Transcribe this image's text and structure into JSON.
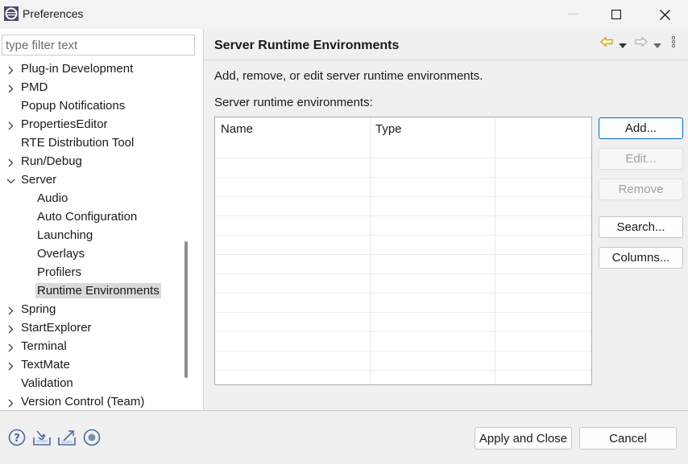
{
  "window": {
    "title": "Preferences",
    "icons": [
      "eclipse-app-icon",
      "minimize-icon",
      "maximize-icon",
      "close-icon"
    ]
  },
  "sidebar": {
    "filter_placeholder": "type filter text",
    "items": [
      {
        "label": "Plug-in Development",
        "level": 0,
        "expandable": true,
        "expanded": false
      },
      {
        "label": "PMD",
        "level": 0,
        "expandable": true,
        "expanded": false
      },
      {
        "label": "Popup Notifications",
        "level": 0,
        "expandable": false
      },
      {
        "label": "PropertiesEditor",
        "level": 0,
        "expandable": true,
        "expanded": false
      },
      {
        "label": "RTE Distribution Tool",
        "level": 0,
        "expandable": false
      },
      {
        "label": "Run/Debug",
        "level": 0,
        "expandable": true,
        "expanded": false
      },
      {
        "label": "Server",
        "level": 0,
        "expandable": true,
        "expanded": true
      },
      {
        "label": "Audio",
        "level": 1,
        "expandable": false
      },
      {
        "label": "Auto Configuration",
        "level": 1,
        "expandable": false
      },
      {
        "label": "Launching",
        "level": 1,
        "expandable": false
      },
      {
        "label": "Overlays",
        "level": 1,
        "expandable": false
      },
      {
        "label": "Profilers",
        "level": 1,
        "expandable": false
      },
      {
        "label": "Runtime Environments",
        "level": 1,
        "expandable": false,
        "selected": true
      },
      {
        "label": "Spring",
        "level": 0,
        "expandable": true,
        "expanded": false
      },
      {
        "label": "StartExplorer",
        "level": 0,
        "expandable": true,
        "expanded": false
      },
      {
        "label": "Terminal",
        "level": 0,
        "expandable": true,
        "expanded": false
      },
      {
        "label": "TextMate",
        "level": 0,
        "expandable": true,
        "expanded": false
      },
      {
        "label": "Validation",
        "level": 0,
        "expandable": false
      },
      {
        "label": "Version Control (Team)",
        "level": 0,
        "expandable": true,
        "expanded": false
      }
    ]
  },
  "main": {
    "title": "Server Runtime Environments",
    "description": "Add, remove, or edit server runtime environments.",
    "list_label": "Server runtime environments:",
    "table": {
      "columns": [
        "Name",
        "Type",
        ""
      ],
      "rows": []
    },
    "buttons": {
      "add": "Add...",
      "edit": "Edit...",
      "remove": "Remove",
      "search": "Search...",
      "columns": "Columns..."
    },
    "nav_icons": [
      "back-arrow-icon",
      "back-menu-icon",
      "forward-arrow-icon",
      "forward-menu-icon",
      "view-menu-icon"
    ]
  },
  "footer": {
    "icons": [
      "help-icon",
      "import-icon",
      "export-icon",
      "record-icon"
    ],
    "apply_close": "Apply and Close",
    "cancel": "Cancel"
  },
  "colors": {
    "accent": "#0067c0",
    "selection": "#d9d9d9",
    "nav_arrow": "#d4a017"
  }
}
